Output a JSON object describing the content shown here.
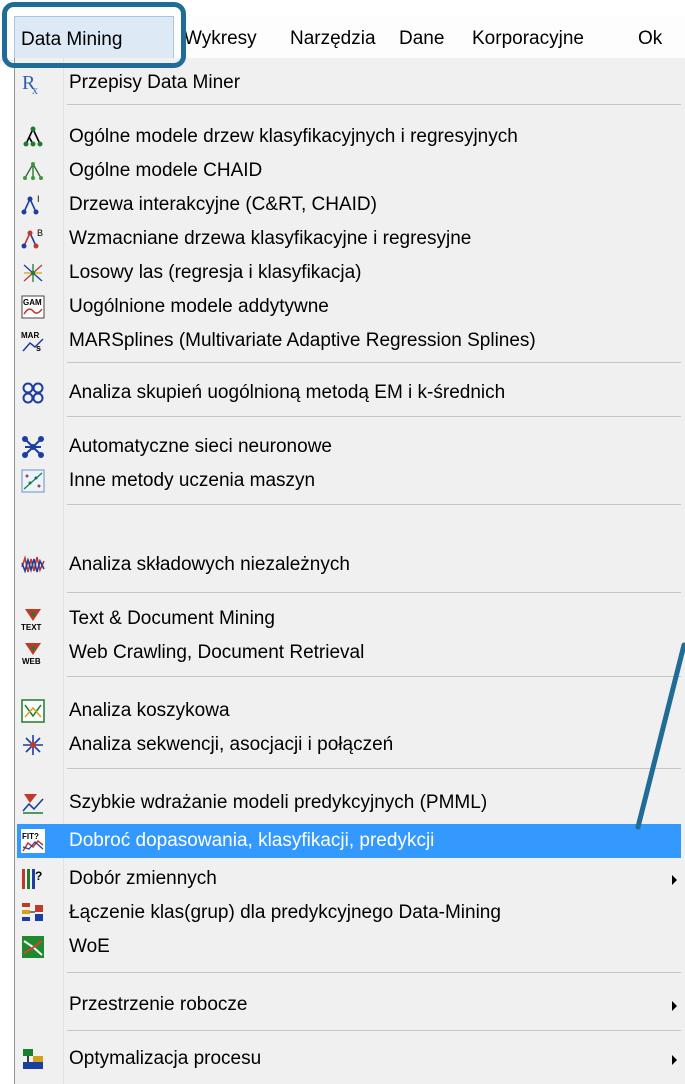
{
  "menubar": {
    "items": [
      "Data Mining",
      "Wykresy",
      "Narzędzia",
      "Dane",
      "Korporacyjne",
      "Ok"
    ]
  },
  "menu": {
    "items": [
      {
        "label": "Przepisy Data Miner",
        "icon": "rx-icon"
      },
      {
        "label": "Ogólne modele drzew klasyfikacyjnych i regresyjnych",
        "icon": "tree-icon"
      },
      {
        "label": "Ogólne modele CHAID",
        "icon": "chaid-tree-icon"
      },
      {
        "label": "Drzewa interakcyjne (C&RT, CHAID)",
        "icon": "interactive-tree-icon"
      },
      {
        "label": "Wzmacniane drzewa klasyfikacyjne i regresyjne",
        "icon": "boosted-tree-icon"
      },
      {
        "label": "Losowy las (regresja i klasyfikacja)",
        "icon": "random-forest-icon"
      },
      {
        "label": "Uogólnione modele addytywne",
        "icon": "gam-icon"
      },
      {
        "label": "MARSplines (Multivariate Adaptive Regression Splines)",
        "icon": "mars-icon"
      },
      {
        "label": "Analiza skupień uogólnioną metodą EM i k-średnich",
        "icon": "cluster-icon"
      },
      {
        "label": "Automatyczne sieci neuronowe",
        "icon": "neural-network-icon"
      },
      {
        "label": "Inne metody uczenia maszyn",
        "icon": "machine-learning-icon"
      },
      {
        "label": "Analiza składowych niezależnych",
        "icon": "ica-icon"
      },
      {
        "label": "Text & Document Mining",
        "icon": "text-mining-icon"
      },
      {
        "label": "Web Crawling, Document Retrieval",
        "icon": "web-crawl-icon"
      },
      {
        "label": "Analiza koszykowa",
        "icon": "basket-icon"
      },
      {
        "label": "Analiza sekwencji, asocjacji i połączeń",
        "icon": "association-icon"
      },
      {
        "label": "Szybkie wdrażanie modeli predykcyjnych (PMML)",
        "icon": "pmml-icon"
      },
      {
        "label": "Dobroć dopasowania, klasyfikacji, predykcji",
        "icon": "goodness-of-fit-icon"
      },
      {
        "label": "Dobór zmiennych",
        "icon": "feature-selection-icon"
      },
      {
        "label": "Łączenie klas(grup) dla predykcyjnego Data-Mining",
        "icon": "class-merge-icon"
      },
      {
        "label": "WoE",
        "icon": "woe-icon"
      },
      {
        "label": "Przestrzenie robocze"
      },
      {
        "label": "Optymalizacja procesu",
        "icon": "process-optimization-icon"
      }
    ]
  },
  "colors": {
    "highlight": "#3399ff",
    "callout": "#1f6d96",
    "menu_background": "#f0f0f0"
  }
}
